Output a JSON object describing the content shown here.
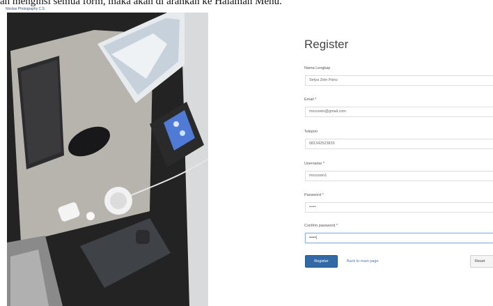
{
  "caption": "an menginsi semua form, maka akan di arahkan ke Halaman Menu.",
  "photo_credit": "Nicolas Photography C.S.",
  "form": {
    "title": "Register",
    "fields": [
      {
        "label": "Nama Lengkap",
        "value": "Setya Zein Panu"
      },
      {
        "label": "Email *",
        "value": "mrcozein@gmail.com"
      },
      {
        "label": "Telepon",
        "value": "081342523833"
      },
      {
        "label": "Username *",
        "value": "mrcozein1"
      },
      {
        "label": "Password *",
        "value": "•••••"
      },
      {
        "label": "Confirm password *",
        "value": "•••••|"
      }
    ],
    "register_button": "Register",
    "back_link": "Back to main page",
    "reset_button": "Reset"
  },
  "colors": {
    "primary": "#336aa6",
    "link": "#4a7bb8",
    "focus_border": "#8fb3dc"
  }
}
